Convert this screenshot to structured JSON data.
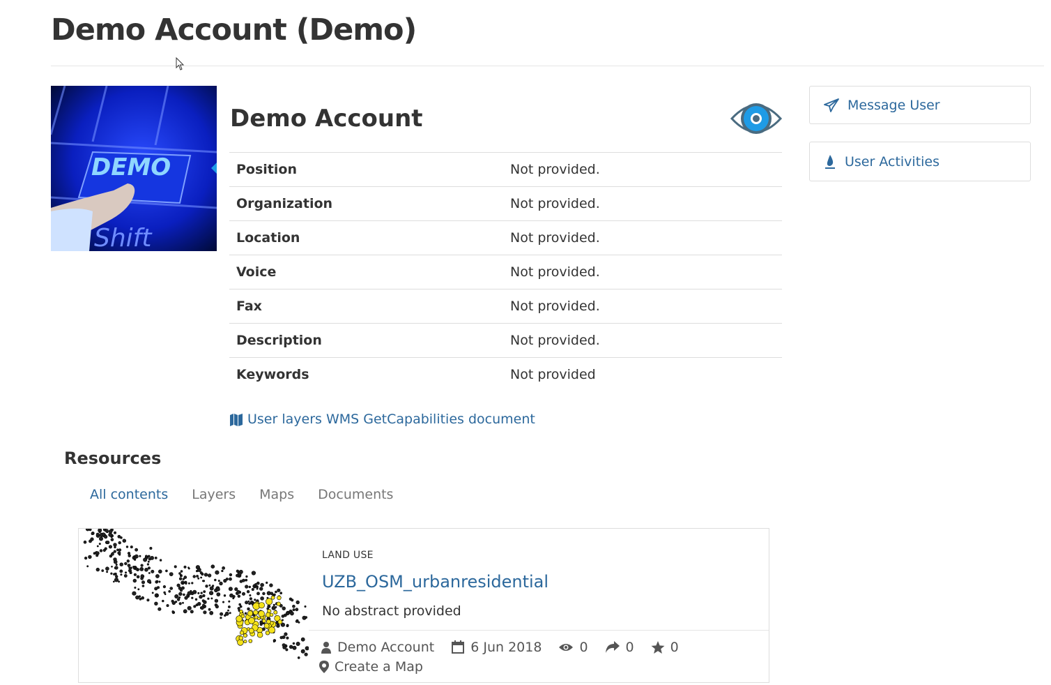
{
  "page": {
    "title": "Demo Account (Demo)"
  },
  "avatar": {
    "text": "DEMO",
    "subtext": "Shift"
  },
  "profile": {
    "name": "Demo Account",
    "fields": [
      {
        "label": "Position",
        "value": "Not provided."
      },
      {
        "label": "Organization",
        "value": "Not provided."
      },
      {
        "label": "Location",
        "value": "Not provided."
      },
      {
        "label": "Voice",
        "value": "Not provided."
      },
      {
        "label": "Fax",
        "value": "Not provided."
      },
      {
        "label": "Description",
        "value": "Not provided."
      },
      {
        "label": "Keywords",
        "value": "Not provided"
      }
    ],
    "wms_link": "User layers WMS GetCapabilities document"
  },
  "actions": {
    "message_user": "Message User",
    "user_activities": "User Activities"
  },
  "resources": {
    "heading": "Resources",
    "tabs": [
      "All contents",
      "Layers",
      "Maps",
      "Documents"
    ],
    "active_tab": "All contents",
    "items": [
      {
        "category": "LAND USE",
        "title": "UZB_OSM_urbanresidential",
        "abstract": "No abstract provided",
        "owner": "Demo Account",
        "date": "6 Jun 2018",
        "views": "0",
        "shares": "0",
        "ratings": "0",
        "action": "Create a Map"
      }
    ]
  },
  "colors": {
    "link": "#2c689c",
    "border": "#dddddd",
    "eye_blue": "#1e9be6",
    "eye_ring": "#4a6b80"
  }
}
